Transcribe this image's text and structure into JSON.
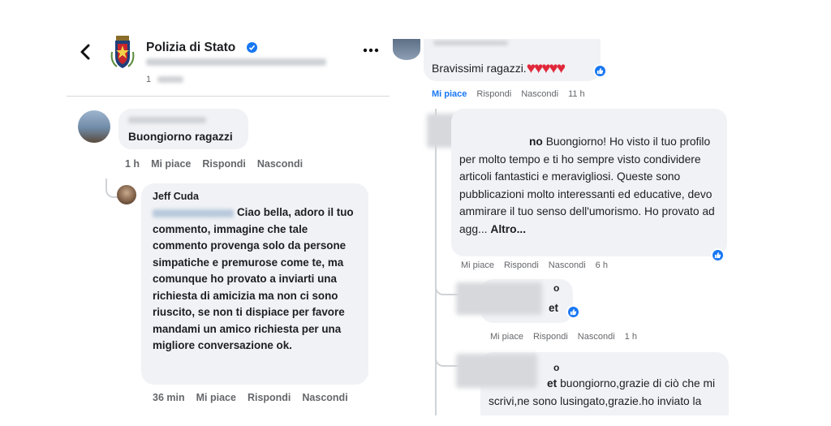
{
  "left": {
    "header": {
      "back_icon": "chevron-left-icon",
      "page_name": "Polizia di Stato",
      "verified_icon": "verified-badge-icon",
      "subtitle_prefix": "1",
      "more_icon": "more-horizontal-icon"
    },
    "comment": {
      "text": "Buongiorno ragazzi",
      "time": "1 h",
      "like": "Mi piace",
      "reply": "Rispondi",
      "hide": "Nascondi"
    },
    "reply": {
      "author": "Jeff Cuda",
      "text": "Ciao bella, adoro il tuo commento, immagine che tale commento provenga solo da persone simpatiche e premurose come te, ma comunque ho provato a inviarti una richiesta di amicizia ma non ci sono riuscito, se non ti dispiace per favore mandami un amico  richiesta per una migliore conversazione ok.",
      "time": "36 min",
      "like": "Mi piace",
      "reply": "Rispondi",
      "hide": "Nascondi"
    }
  },
  "right": {
    "top_comment": {
      "text": "Bravissimi ragazzi.",
      "hearts": "♥♥♥♥♥",
      "like": "Mi piace",
      "reply": "Rispondi",
      "hide": "Nascondi",
      "time": "11 h",
      "like_color": "#1877f2"
    },
    "reply1": {
      "name_fragment": "no",
      "text": "Buongiorno! Ho visto il tuo profilo per molto tempo e ti ho sempre visto condividere articoli fantastici e meravigliosi. Queste sono pubblicazioni molto interessanti ed educative, devo ammirare il tuo senso dell'umorismo. Ho provato ad agg...",
      "more": "Altro...",
      "like": "Mi piace",
      "reply": "Rispondi",
      "hide": "Nascondi",
      "time": "6 h"
    },
    "reply2": {
      "name_fragment": "o",
      "text": "et",
      "like": "Mi piace",
      "reply": "Rispondi",
      "hide": "Nascondi",
      "time": "1 h"
    },
    "reply3": {
      "name_fragment": "o",
      "text_bold": "et",
      "text": " buongiorno,grazie di ciò che mi scrivi,ne sono lusingato,grazie.ho inviato la"
    }
  }
}
